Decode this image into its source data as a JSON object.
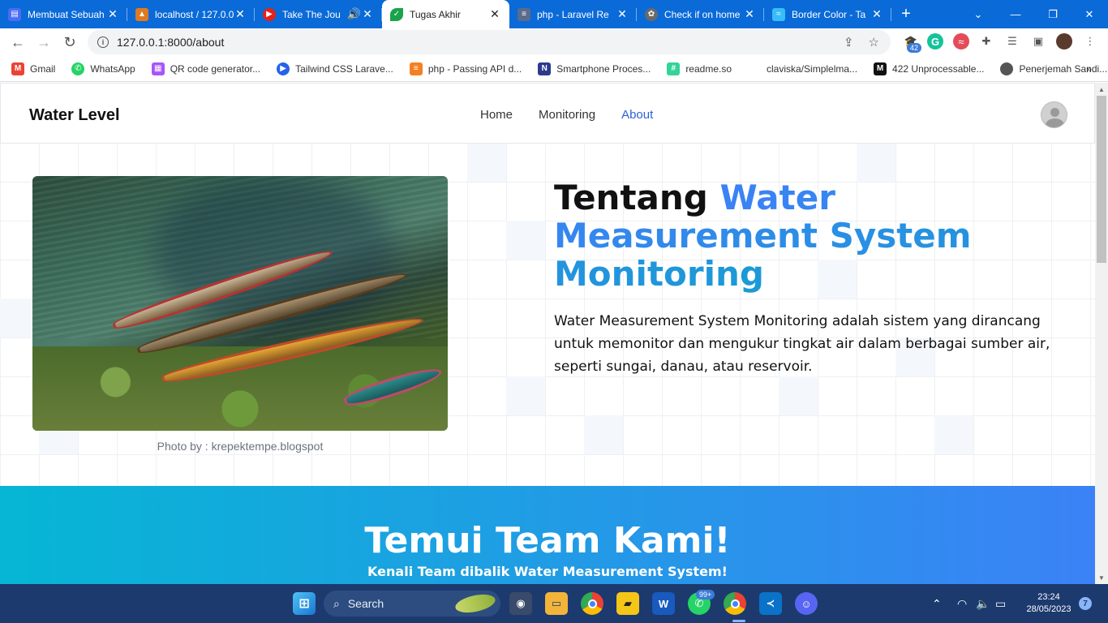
{
  "browser": {
    "tabs": [
      {
        "title": "Membuat Sebuah",
        "color": "#4a6cf7",
        "icon": "doc-icon"
      },
      {
        "title": "localhost / 127.0.0",
        "color": "#e07a1f",
        "icon": "phpmyadmin-icon"
      },
      {
        "title": "Take The Jou",
        "color": "#e62117",
        "icon": "youtube-icon"
      },
      {
        "title": "Tugas Akhir",
        "color": "#19a34a",
        "icon": "leaf-icon"
      },
      {
        "title": "php - Laravel Re",
        "color": "#5b6b8c",
        "icon": "stackoverflow-icon"
      },
      {
        "title": "Check if on home",
        "color": "#6a6a6a",
        "icon": "chatgpt-icon"
      },
      {
        "title": "Border Color - Ta",
        "color": "#38bdf8",
        "icon": "tailwind-icon"
      }
    ],
    "active_tab_index": 3,
    "url": "127.0.0.1:8000/about",
    "extension_badge": "42",
    "bookmarks": [
      {
        "label": "Gmail",
        "color": "#ea4335",
        "icon": "gmail-icon"
      },
      {
        "label": "WhatsApp",
        "color": "#25d366",
        "icon": "whatsapp-icon"
      },
      {
        "label": "QR code generator...",
        "color": "#a855f7",
        "icon": "qr-icon"
      },
      {
        "label": "Tailwind CSS Larave...",
        "color": "#2563eb",
        "icon": "play-icon"
      },
      {
        "label": "php - Passing API d...",
        "color": "#f48024",
        "icon": "stackoverflow-icon"
      },
      {
        "label": "Smartphone Proces...",
        "color": "#2d3a8c",
        "icon": "n-icon"
      },
      {
        "label": "readme.so",
        "color": "#34d399",
        "icon": "hash-icon"
      },
      {
        "label": "claviska/Simplelma...",
        "color": "#ffffff",
        "icon": "blank-icon"
      },
      {
        "label": "422 Unprocessable...",
        "color": "#111111",
        "icon": "m-icon"
      },
      {
        "label": "Penerjemah Sandi...",
        "color": "#555555",
        "icon": "globe-icon"
      }
    ]
  },
  "page": {
    "brand": "Water Level",
    "nav": [
      {
        "label": "Home",
        "active": false
      },
      {
        "label": "Monitoring",
        "active": false
      },
      {
        "label": "About",
        "active": true
      }
    ],
    "caption": "Photo by : krepektempe.blogspot",
    "heading_plain": "Tentang ",
    "heading_accent": "Water Measurement System Monitoring",
    "paragraph": "Water Measurement System Monitoring adalah sistem yang dirancang untuk memonitor dan mengukur tingkat air dalam berbagai sumber air, seperti sungai, danau, atau reservoir.",
    "team_title": "Temui Team Kami!",
    "team_subtitle": "Kenali Team dibalik Water Measurement System!",
    "accent_color": "#3b82f6"
  },
  "taskbar": {
    "search_placeholder": "Search",
    "whatsapp_badge": "99+",
    "time": "23:24",
    "date": "28/05/2023",
    "notifications": "7"
  }
}
